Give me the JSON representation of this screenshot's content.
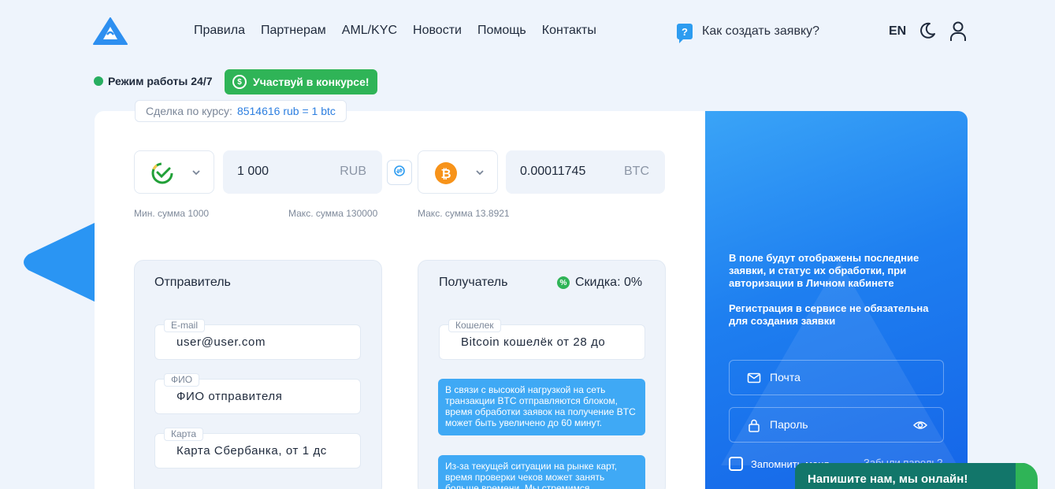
{
  "header": {
    "nav": [
      "Правила",
      "Партнерам",
      "AML/KYC",
      "Новости",
      "Помощь",
      "Контакты"
    ],
    "howto": "Как создать заявку?",
    "howto_icon": "?",
    "lang": "EN"
  },
  "status": {
    "work_mode": "Режим работы 24/7",
    "contest": "Участвуй в конкурсе!",
    "contest_icon": "$"
  },
  "rate": {
    "label": "Сделка по курсу:",
    "value": "8514616 rub = 1 btc"
  },
  "exchange": {
    "give_amount": "1 000",
    "give_currency": "RUB",
    "get_amount": "0.00011745",
    "get_currency": "BTC",
    "min": "Мин. сумма 1000",
    "max_give": "Макс. сумма 130000",
    "max_get": "Макс. сумма 13.8921"
  },
  "sender": {
    "title": "Отправитель",
    "fields": [
      {
        "label": "E-mail",
        "value": "user@user.com"
      },
      {
        "label": "ФИО",
        "value": "ФИО отправителя"
      },
      {
        "label": "Карта",
        "value": "Карта Сбербанка, от 1 дс"
      }
    ]
  },
  "receiver": {
    "title": "Получатель",
    "discount": "Скидка: 0%",
    "discount_icon": "%",
    "wallet_label": "Кошелек",
    "wallet_value": "Bitcoin кошелёк от 28 до",
    "notice1": "В связи с высокой нагрузкой на сеть транзакции BTC отправляются блоком, время обработки заявок на получение BTC может быть увеличено до 60 минут.",
    "notice2": "Из-за текущей ситуации на рынке карт, время проверки чеков может занять больше времени. Мы стремимся"
  },
  "auth": {
    "text1": "В поле будут отображены последние заявки, и статус их обработки, при авторизации в Личном кабинете",
    "text2": "Регистрация в сервисе не обязательна для создания заявки",
    "email_placeholder": "Почта",
    "password_placeholder": "Пароль",
    "remember": "Запомнить меня",
    "forgot": "Забыли пароль?"
  },
  "chat": {
    "label": "Напишите нам, мы онлайн!"
  },
  "colors": {
    "accent": "#2d9cf0",
    "green": "#2fb457",
    "blue_panel": "#1e7ff0"
  }
}
